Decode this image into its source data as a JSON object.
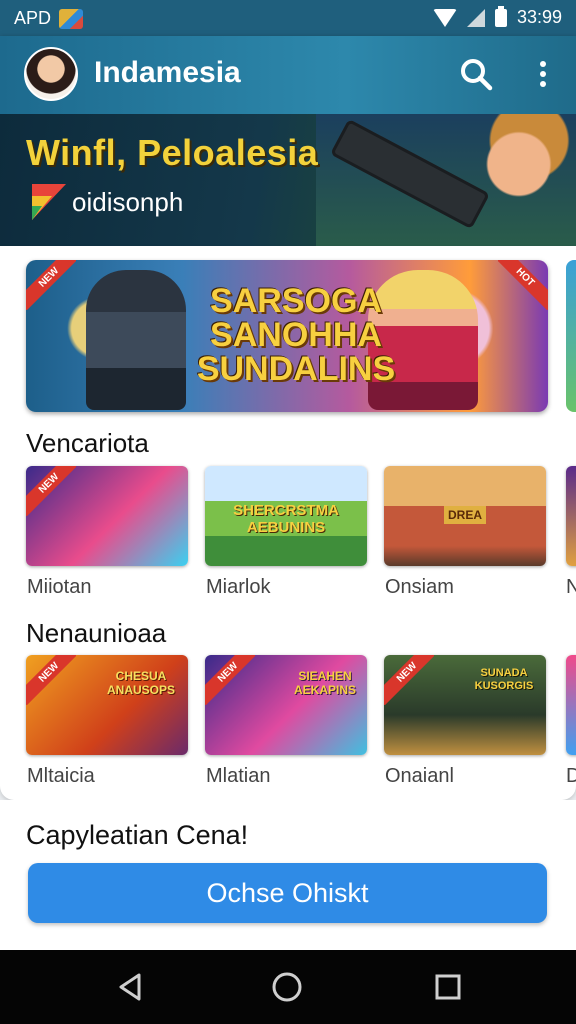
{
  "status_bar": {
    "carrier": "APD",
    "time": "33:99"
  },
  "app_bar": {
    "title": "Indamesia",
    "search_icon": "search-icon",
    "menu_icon": "more-vert-icon"
  },
  "hero": {
    "title": "Winfl, Peloalesia",
    "subtitle": "oidisonph",
    "logo": "play-logo"
  },
  "featured": {
    "title_line1": "SARSOGA",
    "title_line2": "SANOHHA",
    "title_line3": "SUNDALINS",
    "ribbon_left": "NEW",
    "ribbon_right": "HOT"
  },
  "sections": [
    {
      "title": "Vencariota",
      "items": [
        {
          "label": "Miiotan",
          "ribbon": "NEW",
          "colors": [
            "#3b2a8a",
            "#e94c8c",
            "#3bd0f0"
          ]
        },
        {
          "label": "Miarlok",
          "ribbon": "",
          "colors": [
            "#3f8e3a",
            "#7bc04a",
            "#cfe8ff"
          ],
          "caption_line1": "SHERCRSTMA",
          "caption_line2": "AEBUNINS"
        },
        {
          "label": "Onsiam",
          "ribbon": "",
          "colors": [
            "#e8b26a",
            "#c4583a",
            "#5a3a2a"
          ],
          "caption_line1": "DREA"
        },
        {
          "label": "N",
          "ribbon": "",
          "colors": [
            "#5a2a8a",
            "#e0a040"
          ]
        }
      ]
    },
    {
      "title": "Nenaunioaa",
      "items": [
        {
          "label": "Mltaicia",
          "ribbon": "NEW",
          "colors": [
            "#f0a020",
            "#d0401a",
            "#6a2a6a"
          ],
          "caption_line1": "CHESUA",
          "caption_line2": "ANAUSOPS"
        },
        {
          "label": "Mlatian",
          "ribbon": "NEW",
          "colors": [
            "#3a2a8a",
            "#e04aa0",
            "#40c0e0"
          ],
          "caption_line1": "SIEAHEN",
          "caption_line2": "AEKAPINS"
        },
        {
          "label": "Onaianl",
          "ribbon": "NEW",
          "colors": [
            "#2a3a2a",
            "#4a6a3a",
            "#c09040"
          ],
          "caption_line1": "SUNADA",
          "caption_line2": "KUSORGIS"
        },
        {
          "label": "D",
          "ribbon": "",
          "colors": [
            "#f04a8a",
            "#40a0f0"
          ]
        }
      ]
    }
  ],
  "cta": {
    "title": "Capyleatian Cena!",
    "button_label": "Ochse Ohiskt"
  },
  "nav_bar": {
    "back_icon": "back-icon",
    "home_icon": "home-icon",
    "recents_icon": "recents-icon"
  }
}
